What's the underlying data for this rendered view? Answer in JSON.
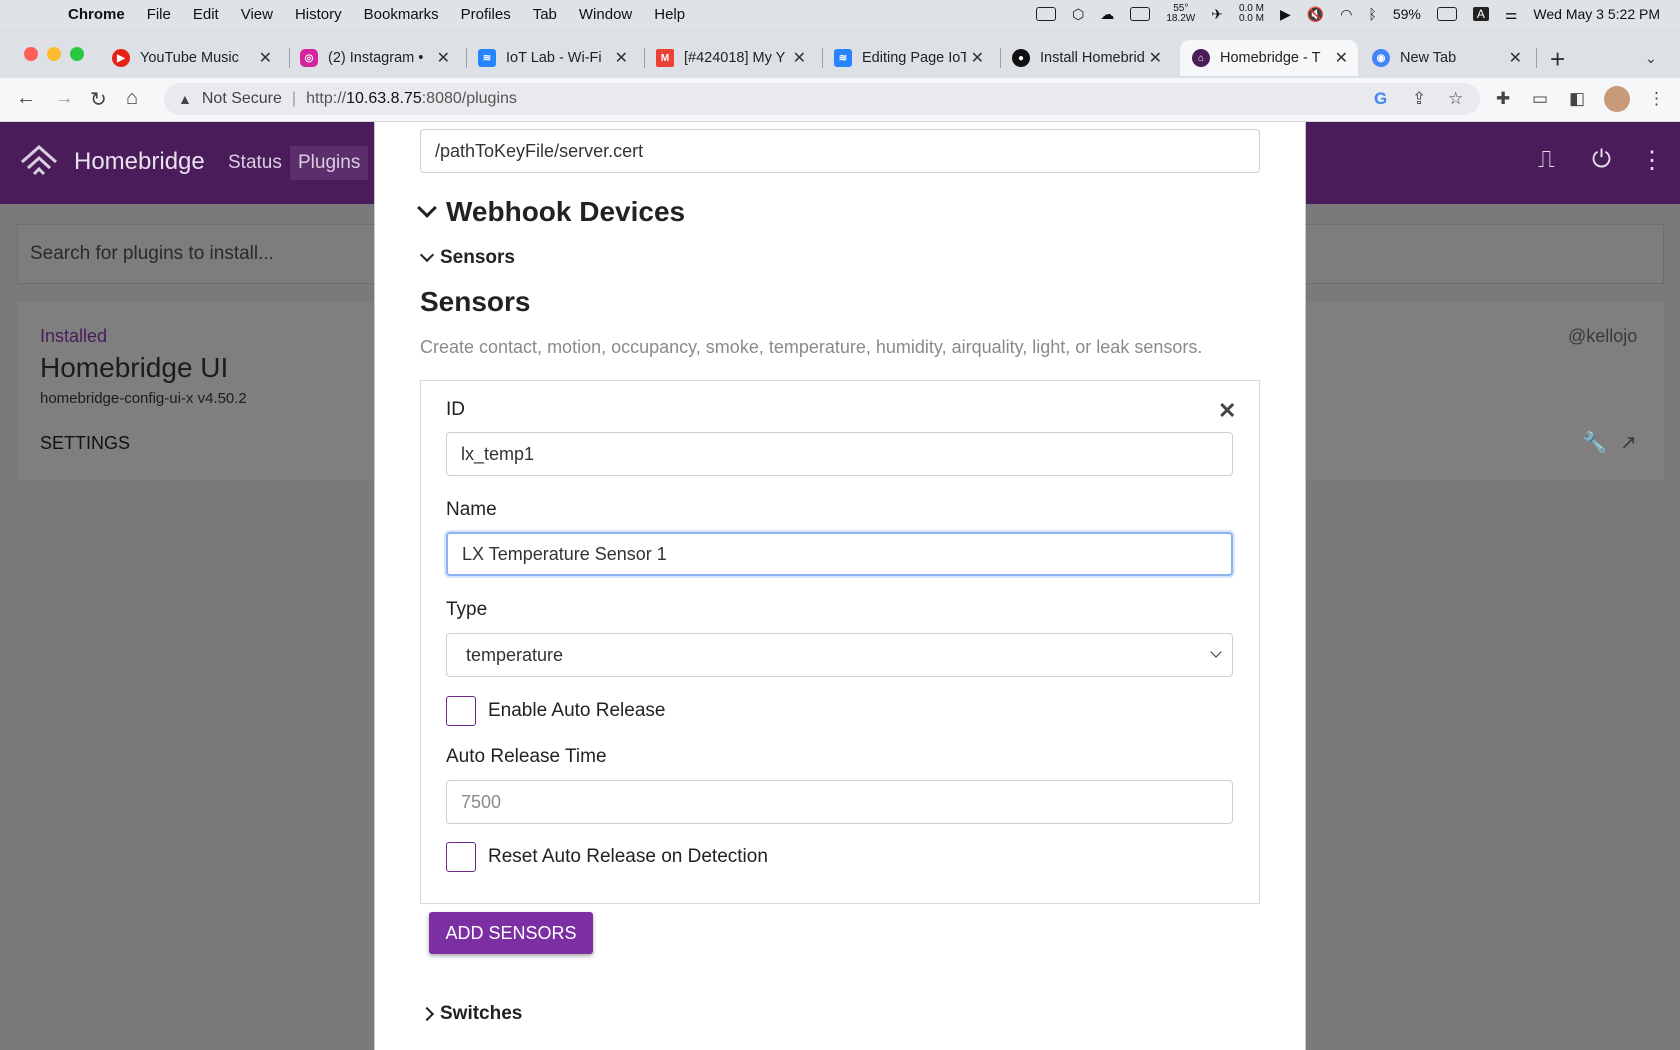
{
  "menubar": {
    "app": "Chrome",
    "items": [
      "File",
      "Edit",
      "View",
      "History",
      "Bookmarks",
      "Profiles",
      "Tab",
      "Window",
      "Help"
    ],
    "temp": "55°",
    "power": "18.2W",
    "net_up": "0.0 M",
    "net_down": "0.0 M",
    "battery": "59%",
    "input_source": "A",
    "clock": "Wed May 3  5:22 PM"
  },
  "tabs": [
    {
      "title": "YouTube Music",
      "icon": "youtube-music-icon",
      "color": "#e62117"
    },
    {
      "title": "(2) Instagram •",
      "icon": "instagram-icon",
      "color": "#d6249f"
    },
    {
      "title": "IoT Lab - Wi-Fi",
      "icon": "confluence-icon",
      "color": "#2684ff"
    },
    {
      "title": "[#424018] My Y",
      "icon": "gmail-icon",
      "color": "#ea4335"
    },
    {
      "title": "Editing Page IoT",
      "icon": "confluence-icon",
      "color": "#2684ff"
    },
    {
      "title": "Install Homebrid",
      "icon": "github-icon",
      "color": "#111111"
    },
    {
      "title": "Homebridge - T",
      "icon": "homebridge-icon",
      "color": "#4a1d5a"
    },
    {
      "title": "New Tab",
      "icon": "chrome-icon",
      "color": "#4285f4"
    }
  ],
  "address_bar": {
    "security": "Not Secure",
    "url_host": "10.63.8.75",
    "url_prefix": "http://",
    "url_rest": ":8080/plugins"
  },
  "homebridge": {
    "title": "Homebridge",
    "nav": [
      "Status",
      "Plugins"
    ],
    "search_placeholder": "Search for plugins to install...",
    "plugin": {
      "status": "Installed",
      "name": "Homebridge UI",
      "package": "homebridge-config-ui-x v4.50.2",
      "settings_label": "SETTINGS",
      "author": "@kellojo"
    }
  },
  "modal": {
    "cert_path_value": "/pathToKeyFile/server.cert",
    "webhook_heading": "Webhook Devices",
    "sensors_toggle": "Sensors",
    "sensors_title": "Sensors",
    "sensors_description": "Create contact, motion, occupancy, smoke, temperature, humidity, airquality, light, or leak sensors.",
    "id_label": "ID",
    "id_value": "lx_temp1",
    "name_label": "Name",
    "name_value": "LX Temperature Sensor 1",
    "type_label": "Type",
    "type_value": "temperature",
    "auto_release_label": "Enable Auto Release",
    "auto_release_time_label": "Auto Release Time",
    "auto_release_time_placeholder": "7500",
    "reset_label": "Reset Auto Release on Detection",
    "add_button": "ADD SENSORS",
    "switches_toggle": "Switches",
    "accent": "#7b2fa3"
  }
}
